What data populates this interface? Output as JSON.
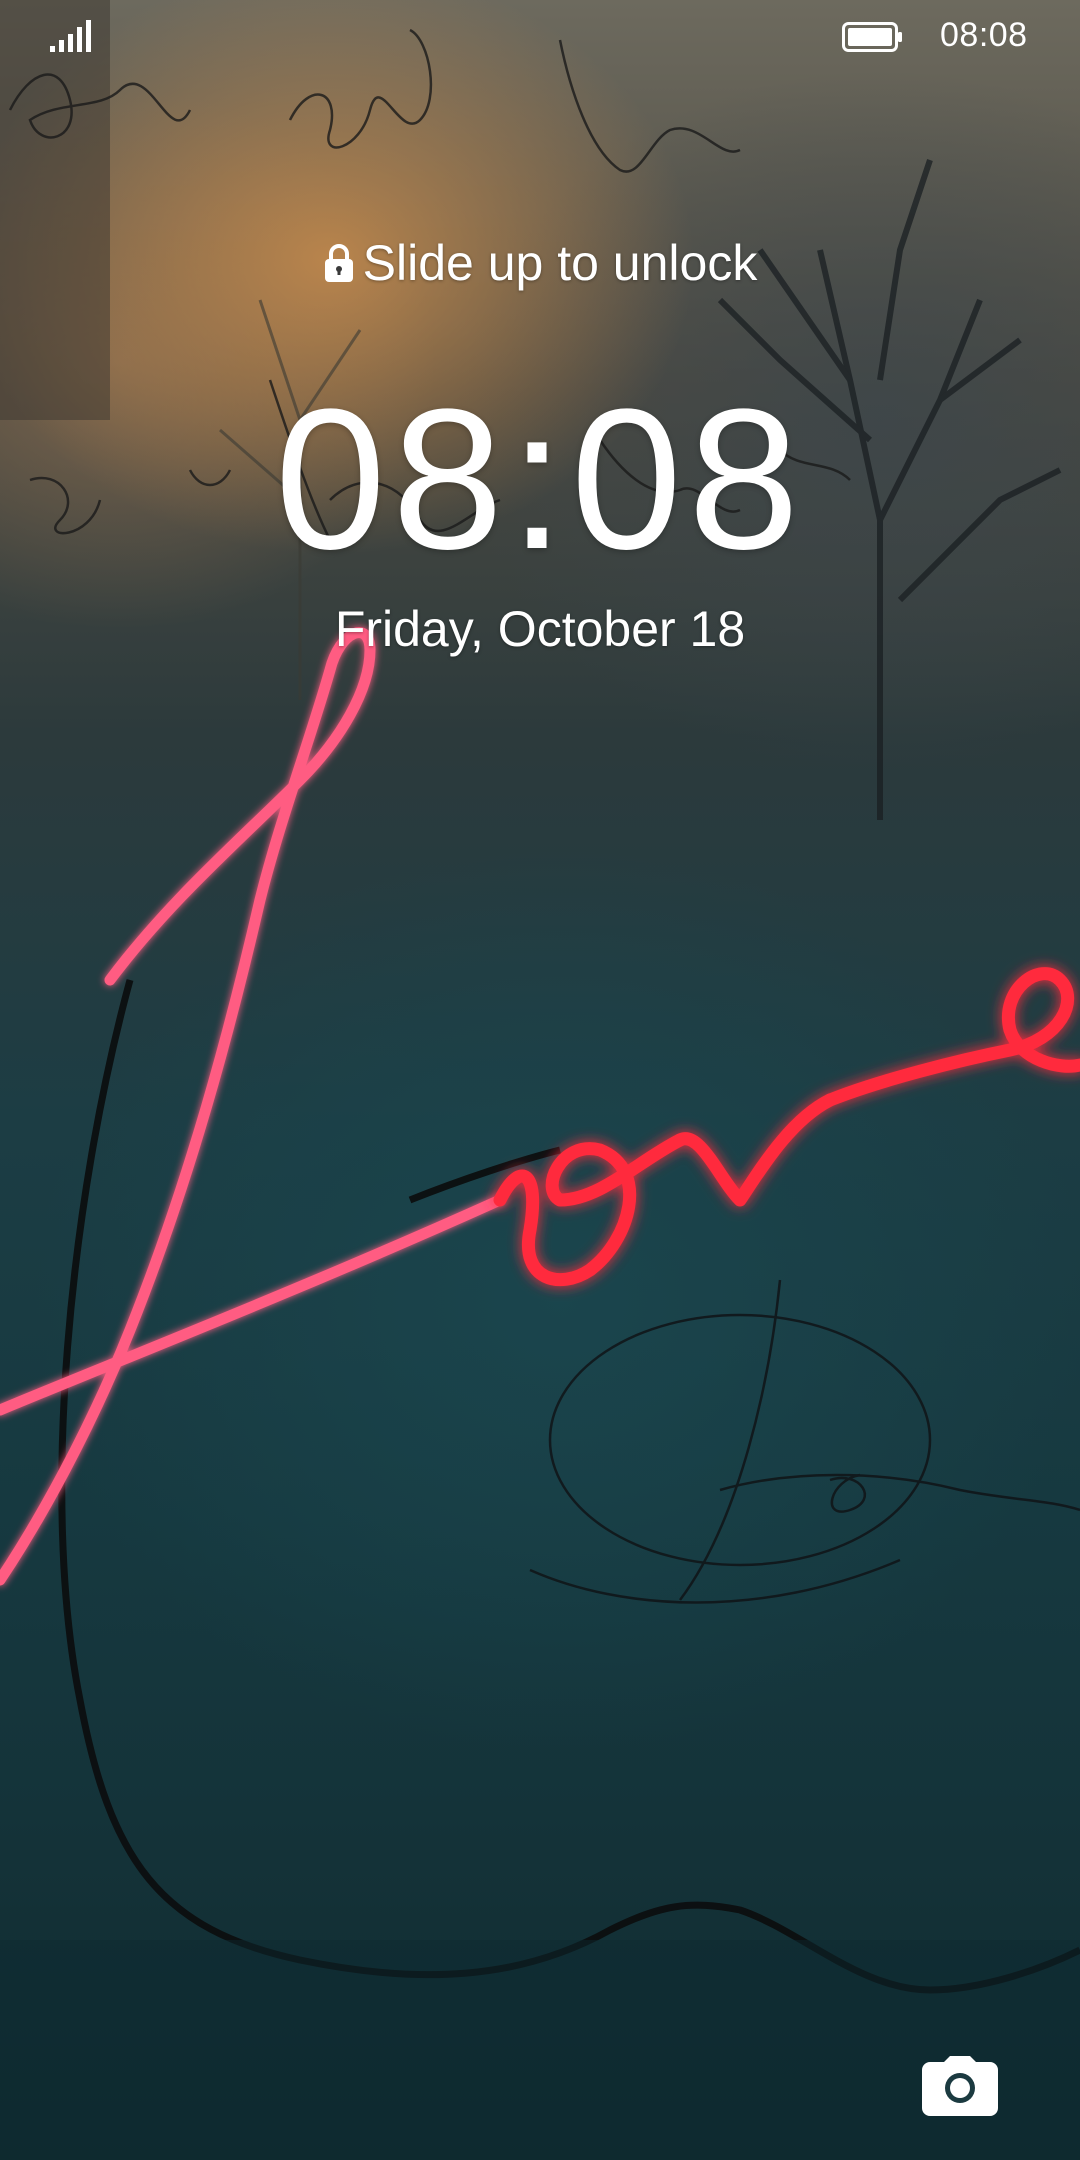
{
  "status_bar": {
    "time": "08:08",
    "signal_icon": "signal-bars-icon",
    "battery_icon": "battery-full-icon"
  },
  "lock_screen": {
    "unlock_hint": "Slide up to unlock",
    "lock_icon": "lock-icon",
    "clock": "08:08",
    "date": "Friday, October 18"
  },
  "shortcuts": {
    "camera_icon": "camera-icon"
  },
  "wallpaper": {
    "subject": "neon love sign",
    "neon_color": "#ff2a3c",
    "neon_pink": "#ff5c82",
    "wall_color": "#163940"
  }
}
